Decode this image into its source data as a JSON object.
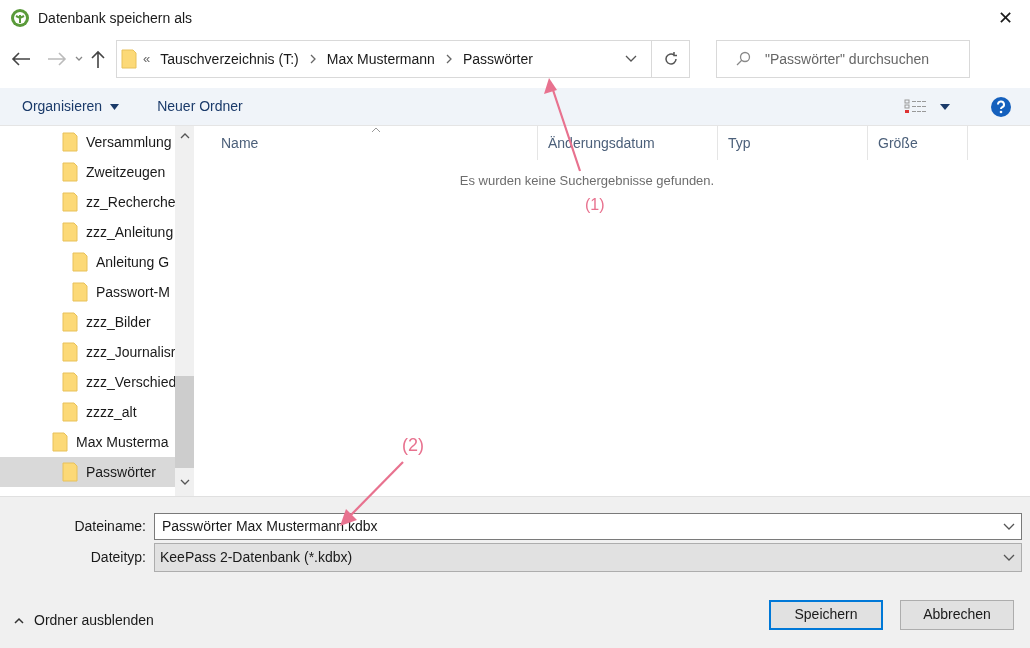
{
  "window": {
    "title": "Datenbank speichern als",
    "close": "✕"
  },
  "nav": {
    "breadcrumb_overflow": "«",
    "path": [
      {
        "label": "Tauschverzeichnis (T:)"
      },
      {
        "label": "Max Mustermann"
      },
      {
        "label": "Passwörter"
      }
    ],
    "search": {
      "placeholder": "\"Passwörter\" durchsuchen"
    }
  },
  "toolbar": {
    "organize": "Organisieren",
    "new_folder": "Neuer Ordner"
  },
  "tree": {
    "upper_items": [
      {
        "label": "Versammlung",
        "selected": false
      },
      {
        "label": "Zweitzeugen",
        "selected": false
      },
      {
        "label": "zz_Recherche",
        "selected": false
      },
      {
        "label": "zzz_Anleitung",
        "selected": false,
        "children": [
          {
            "label": "Anleitung G",
            "selected": false
          },
          {
            "label": "Passwort-M",
            "selected": false
          }
        ]
      },
      {
        "label": "zzz_Bilder",
        "selected": false
      },
      {
        "label": "zzz_Journalisr",
        "selected": false
      },
      {
        "label": "zzz_Verschied",
        "selected": false
      },
      {
        "label": "zzzz_alt",
        "selected": false
      }
    ],
    "items": [
      {
        "label": "Max Musterma",
        "selected": false,
        "children": [
          {
            "label": "Passwörter",
            "selected": true
          }
        ]
      }
    ]
  },
  "table": {
    "columns": [
      {
        "label": "Name"
      },
      {
        "label": "Änderungsdatum"
      },
      {
        "label": "Typ"
      },
      {
        "label": "Größe"
      }
    ],
    "empty_message": "Es wurden keine Suchergebnisse gefunden."
  },
  "form": {
    "filename_label": "Dateiname:",
    "filename": "Passwörter Max Mustermann.kdbx",
    "filetype_label": "Dateityp:",
    "filetype": "KeePass 2-Datenbank (*.kdbx)"
  },
  "footer": {
    "hide_folders": "Ordner ausblenden",
    "buttons": [
      {
        "label": "Speichern",
        "kind": "primary"
      },
      {
        "label": "Abbrechen",
        "kind": "normal"
      }
    ]
  },
  "annotations": [
    {
      "label": "(1)"
    },
    {
      "label": "(2)"
    }
  ]
}
